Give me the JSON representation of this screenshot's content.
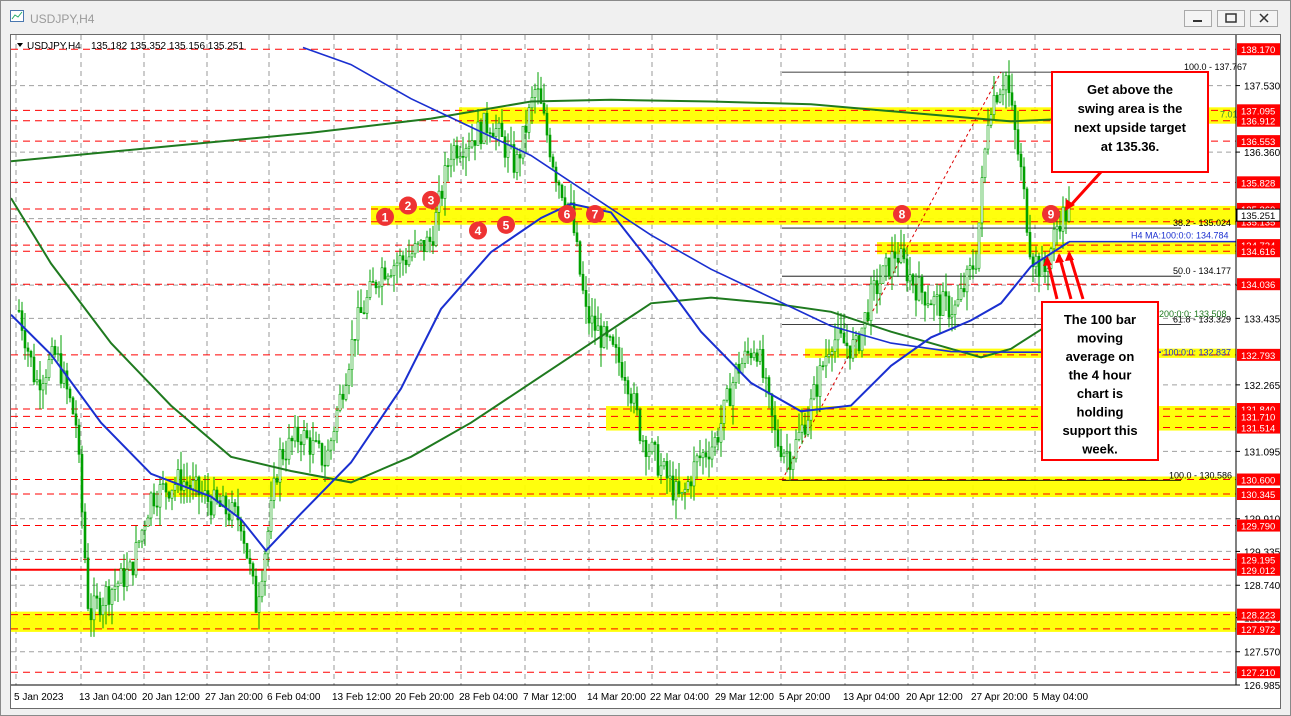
{
  "window": {
    "title": "USDJPY,H4"
  },
  "header": {
    "symbol": "USDJPY,H4",
    "ohlc": "135.182 135.352 135.156 135.251"
  },
  "chart_data": {
    "type": "candlestick",
    "symbol": "USDJPY",
    "timeframe": "H4",
    "ylim": [
      126.985,
      138.42
    ],
    "grid": true,
    "x_tick_labels": [
      "5 Jan 2023",
      "13 Jan 04:00",
      "20 Jan 12:00",
      "27 Jan 20:00",
      "6 Feb 04:00",
      "13 Feb 12:00",
      "20 Feb 20:00",
      "28 Feb 04:00",
      "7 Mar 12:00",
      "14 Mar 20:00",
      "22 Mar 04:00",
      "29 Mar 12:00",
      "5 Apr 20:00",
      "13 Apr 04:00",
      "20 Apr 12:00",
      "27 Apr 20:00",
      "5 May 04:00"
    ],
    "y_tick_labels": [
      "137.530",
      "136.360",
      "135.190",
      "134.020",
      "133.435",
      "132.265",
      "131.095",
      "129.910",
      "129.335",
      "128.740",
      "128.170",
      "127.570",
      "126.985"
    ],
    "price_levels": [
      {
        "label": "138.170",
        "value": 138.17,
        "color": "#ff0000"
      },
      {
        "label": "137.095",
        "value": 137.095,
        "color": "#ff0000"
      },
      {
        "label": "136.912",
        "value": 136.912,
        "color": "#ff0000"
      },
      {
        "label": "136.553",
        "value": 136.553,
        "color": "#ff0000"
      },
      {
        "label": "135.828",
        "value": 135.828,
        "color": "#ff0000"
      },
      {
        "label": "135.360",
        "value": 135.36,
        "color": "#ff0000"
      },
      {
        "label": "135.135",
        "value": 135.135,
        "color": "#ff0000"
      },
      {
        "label": "134.724",
        "value": 134.724,
        "color": "#ff0000"
      },
      {
        "label": "134.616",
        "value": 134.616,
        "color": "#ff0000"
      },
      {
        "label": "134.036",
        "value": 134.036,
        "color": "#ff0000"
      },
      {
        "label": "132.793",
        "value": 132.793,
        "color": "#ff0000"
      },
      {
        "label": "131.840",
        "value": 131.84,
        "color": "#ff0000"
      },
      {
        "label": "131.710",
        "value": 131.71,
        "color": "#ff0000"
      },
      {
        "label": "131.514",
        "value": 131.514,
        "color": "#ff0000"
      },
      {
        "label": "130.600",
        "value": 130.6,
        "color": "#ff0000"
      },
      {
        "label": "130.345",
        "value": 130.345,
        "color": "#ff0000"
      },
      {
        "label": "129.790",
        "value": 129.79,
        "color": "#ff0000"
      },
      {
        "label": "129.195",
        "value": 129.195,
        "color": "#ff0000"
      },
      {
        "label": "129.012",
        "value": 129.012,
        "color": "#ff0000"
      },
      {
        "label": "128.223",
        "value": 128.223,
        "color": "#ff0000"
      },
      {
        "label": "127.972",
        "value": 127.972,
        "color": "#ff0000"
      },
      {
        "label": "127.210",
        "value": 127.21,
        "color": "#ff0000"
      }
    ],
    "current_price": {
      "label": "135.251",
      "value": 135.251
    },
    "zones": [
      {
        "low": 136.912,
        "high": 137.095,
        "from": "28 Feb",
        "to": "right"
      },
      {
        "low": 135.135,
        "high": 135.36,
        "from": "13 Feb",
        "to": "right"
      },
      {
        "low": 134.616,
        "high": 134.724,
        "from": "13 Apr",
        "to": "right"
      },
      {
        "low": 132.793,
        "high": 132.85,
        "from": "5 Apr",
        "to": "right"
      },
      {
        "low": 131.514,
        "high": 131.84,
        "from": "14 Mar",
        "to": "right"
      },
      {
        "low": 130.345,
        "high": 130.6,
        "from": "20 Jan",
        "to": "right"
      },
      {
        "low": 127.972,
        "high": 128.223,
        "from": "left",
        "to": "right"
      }
    ],
    "fibonacci": [
      {
        "label": "100.0 - 137.767",
        "value": 137.767
      },
      {
        "label": "38.2 - 135.024",
        "value": 135.024
      },
      {
        "label": "50.0 - 134.177",
        "value": 134.177
      },
      {
        "label": "61.8 - 133.329",
        "value": 133.329
      },
      {
        "label": "100.0 - 130.586",
        "value": 130.586
      }
    ],
    "moving_averages": [
      {
        "name": "H4 MA:100:0:0",
        "label": "H4 MA:100:0:0: 134.784",
        "value": 134.784,
        "color": "#1a2fd0"
      },
      {
        "name": "200:0:0",
        "label": "200:0:0: 133.508",
        "value": 133.508,
        "color": "#1f7a1f"
      },
      {
        "name": "100:0:0",
        "label": ":100:0:0: 132.837",
        "value": 132.837,
        "color": "#1a2fd0"
      },
      {
        "name": "7.018",
        "label": "7.018",
        "value": 137.018,
        "color": "#3a8a3a"
      }
    ],
    "swing_markers": [
      "1",
      "2",
      "3",
      "4",
      "5",
      "6",
      "7",
      "8",
      "9"
    ],
    "annotations": [
      {
        "text": "Get above the swing area is the next upside target at 135.36."
      },
      {
        "text": "The 100 bar moving average on the 4 hour chart is holding support this week."
      }
    ]
  },
  "colors": {
    "candles": "#00a000",
    "zone": "#ffff00",
    "level": "#ff0000",
    "ma100": "#1a2fd0",
    "ma200": "#1f7a1f",
    "marker": "#ee3333"
  }
}
